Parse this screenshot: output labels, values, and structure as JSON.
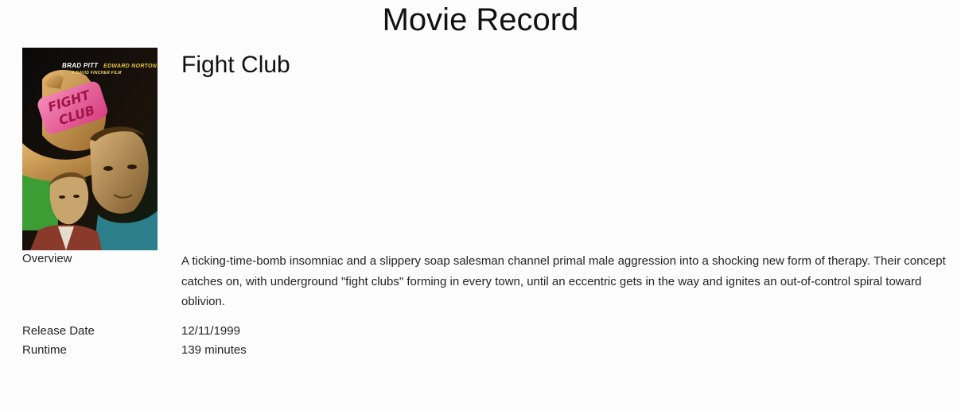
{
  "page": {
    "title": "Movie Record"
  },
  "movie": {
    "title": "Fight Club",
    "poster": {
      "credit_actor1": "BRAD PITT",
      "credit_actor2": "EDWARD NORTON",
      "credit_director": "A DAVID FINCHER FILM",
      "soap_text_line1": "FIGHT",
      "soap_text_line2": "CLUB"
    },
    "overview_label": "Overview",
    "overview": "A ticking-time-bomb insomniac and a slippery soap salesman channel primal male aggression into a shocking new form of therapy. Their concept catches on, with underground \"fight clubs\" forming in every town, until an eccentric gets in the way and ignites an out-of-control spiral toward oblivion.",
    "release_date_label": "Release Date",
    "release_date": "12/11/1999",
    "runtime_label": "Runtime",
    "runtime": "139 minutes"
  },
  "colors": {
    "background": "#fdfdfd",
    "text": "#222222",
    "soap_pink": "#e8508f"
  }
}
